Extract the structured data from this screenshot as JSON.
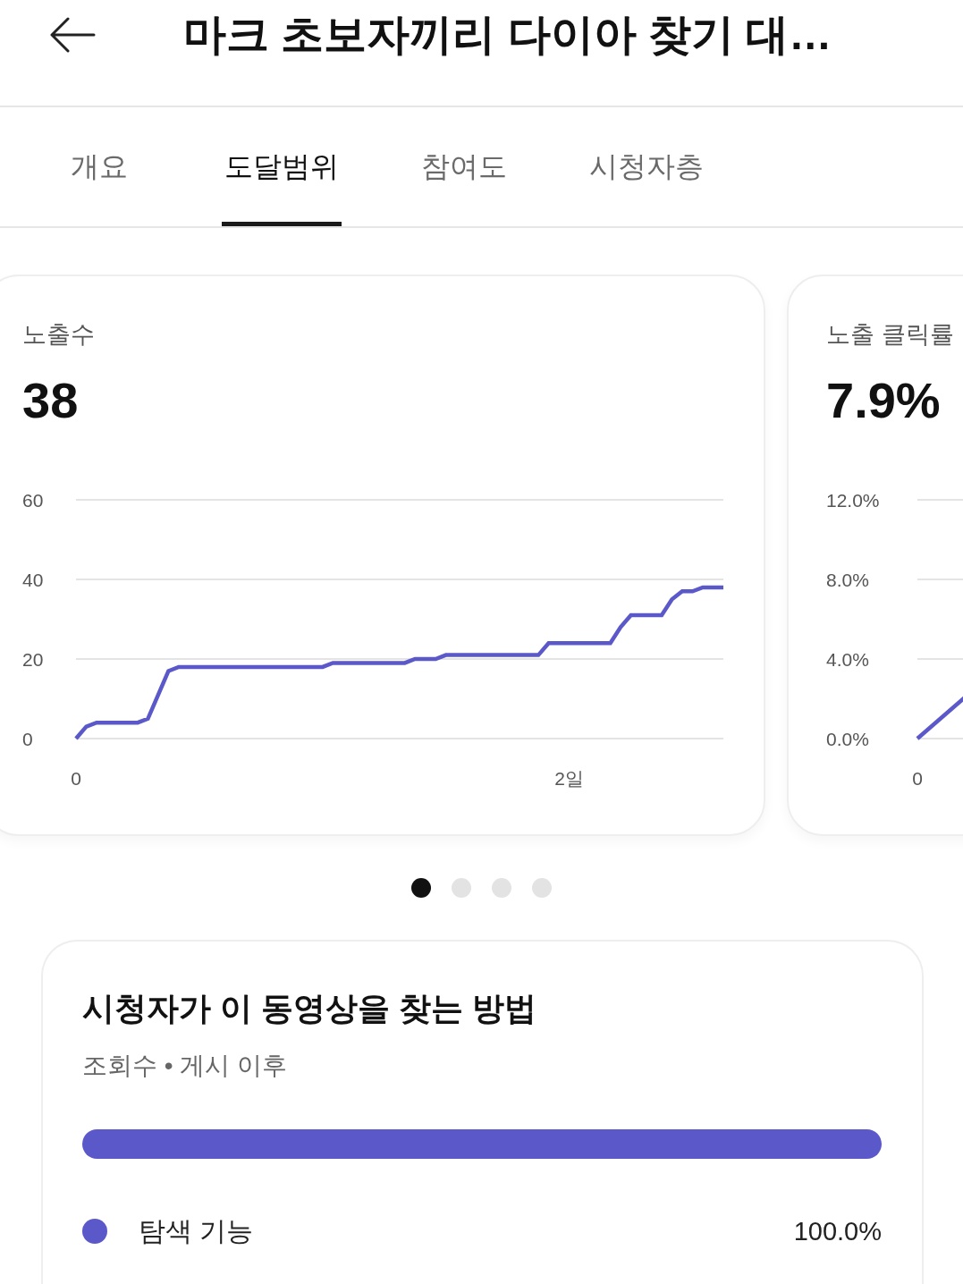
{
  "header": {
    "title": "마크 초보자끼리 다이아 찾기 대…"
  },
  "tabs": [
    {
      "label": "개요",
      "selected": false
    },
    {
      "label": "도달범위",
      "selected": true
    },
    {
      "label": "참여도",
      "selected": false
    },
    {
      "label": "시청자층",
      "selected": false
    }
  ],
  "metric_cards": [
    {
      "kind": "chart",
      "title": "노출수",
      "value": "38",
      "chart_data": {
        "type": "line",
        "categories": [
          "0",
          null,
          null,
          null,
          null,
          null,
          null,
          null,
          null,
          null,
          null,
          null,
          null,
          null,
          null,
          null,
          null,
          null,
          null,
          null,
          null,
          null,
          null,
          null,
          null,
          null,
          null,
          null,
          null,
          null,
          null,
          null,
          null,
          null,
          null,
          null,
          null,
          null,
          null,
          null,
          null,
          null,
          null,
          null,
          null,
          null,
          null,
          null,
          "2일",
          null,
          null,
          null,
          null,
          null,
          null,
          null,
          null,
          null,
          null,
          null,
          null,
          null,
          null,
          null
        ],
        "series": [
          {
            "color": "#5b58c9",
            "values": [
              0,
              3,
              4,
              4,
              4,
              4,
              4,
              5,
              11,
              17,
              18,
              18,
              18,
              18,
              18,
              18,
              18,
              18,
              18,
              18,
              18,
              18,
              18,
              18,
              18,
              19,
              19,
              19,
              19,
              19,
              19,
              19,
              19,
              20,
              20,
              20,
              21,
              21,
              21,
              21,
              21,
              21,
              21,
              21,
              21,
              21,
              24,
              24,
              24,
              24,
              24,
              24,
              24,
              28,
              31,
              31,
              31,
              31,
              35,
              37,
              37,
              38,
              38,
              38
            ]
          }
        ],
        "ylim": [
          0,
          60
        ],
        "yticks": [
          0,
          20,
          40,
          60
        ]
      }
    },
    {
      "kind": "sketch",
      "title": "노출 클릭률",
      "value": "7.9%",
      "y_labels": [
        "12.0%",
        "8.0%",
        "4.0%",
        "0.0%"
      ],
      "x_labels": [
        "0"
      ]
    }
  ],
  "pager": [
    {
      "selected": true
    },
    {
      "selected": false
    },
    {
      "selected": false
    },
    {
      "selected": false
    }
  ],
  "traffic_sources": {
    "title": "시청자가 이 동영상을 찾는 방법",
    "subtitle": "조회수 • 게시 이후",
    "sources": [
      {
        "label": "탐색 기능",
        "value": "100.0%",
        "level": 1,
        "color": "#5b58c9"
      }
    ]
  }
}
